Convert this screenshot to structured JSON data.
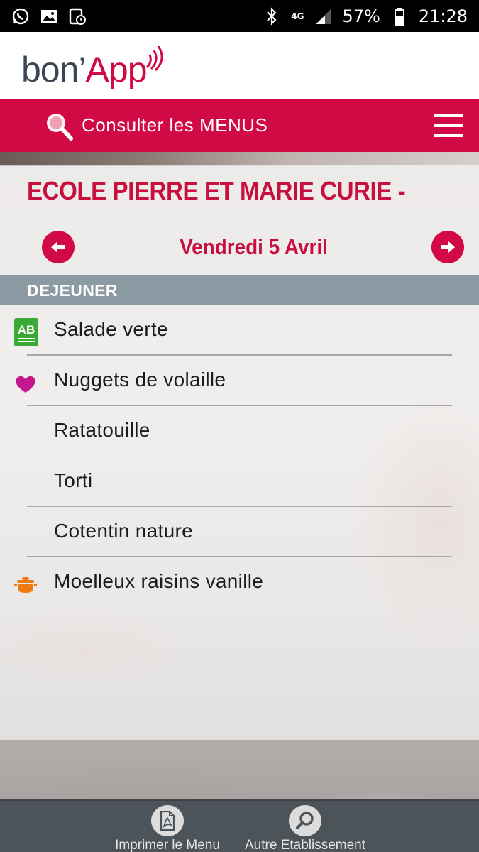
{
  "status_bar": {
    "battery": "57%",
    "time": "21:28",
    "network": "4G",
    "icons_left": [
      "whatsapp-icon",
      "gallery-icon",
      "calendar-sync-icon"
    ],
    "icons_right": [
      "bluetooth-icon",
      "network-icon",
      "signal-icon",
      "battery-icon"
    ]
  },
  "header": {
    "logo_part1": "bon’",
    "logo_part2": "App",
    "logo_colors": {
      "bon": "#3a4654",
      "app": "#d10a45"
    }
  },
  "navbar": {
    "label": "Consulter les MENUS",
    "color": "#d10a45",
    "icons": [
      "search-icon",
      "hamburger-menu-icon"
    ]
  },
  "school": {
    "name": "ECOLE PIERRE ET MARIE CURIE -"
  },
  "date_nav": {
    "date": "Vendredi 5 Avril",
    "prev_icon": "arrow-left-icon",
    "next_icon": "arrow-right-icon"
  },
  "meal": {
    "name": "DEJEUNER",
    "items": [
      {
        "label": "Salade verte",
        "badge": "bio-ab-icon",
        "divider": true
      },
      {
        "label": "Nuggets de volaille",
        "badge": "heart-icon",
        "divider": true
      },
      {
        "label": "Ratatouille",
        "badge": "",
        "divider": false
      },
      {
        "label": "Torti",
        "badge": "",
        "divider": true
      },
      {
        "label": "Cotentin nature",
        "badge": "",
        "divider": true
      },
      {
        "label": "Moelleux raisins vanille",
        "badge": "homemade-pot-icon",
        "divider": false
      }
    ]
  },
  "bottom_bar": {
    "print_label": "Imprimer le Menu",
    "other_label": "Autre Etablissement",
    "icons": [
      "pdf-icon",
      "search-icon"
    ]
  }
}
